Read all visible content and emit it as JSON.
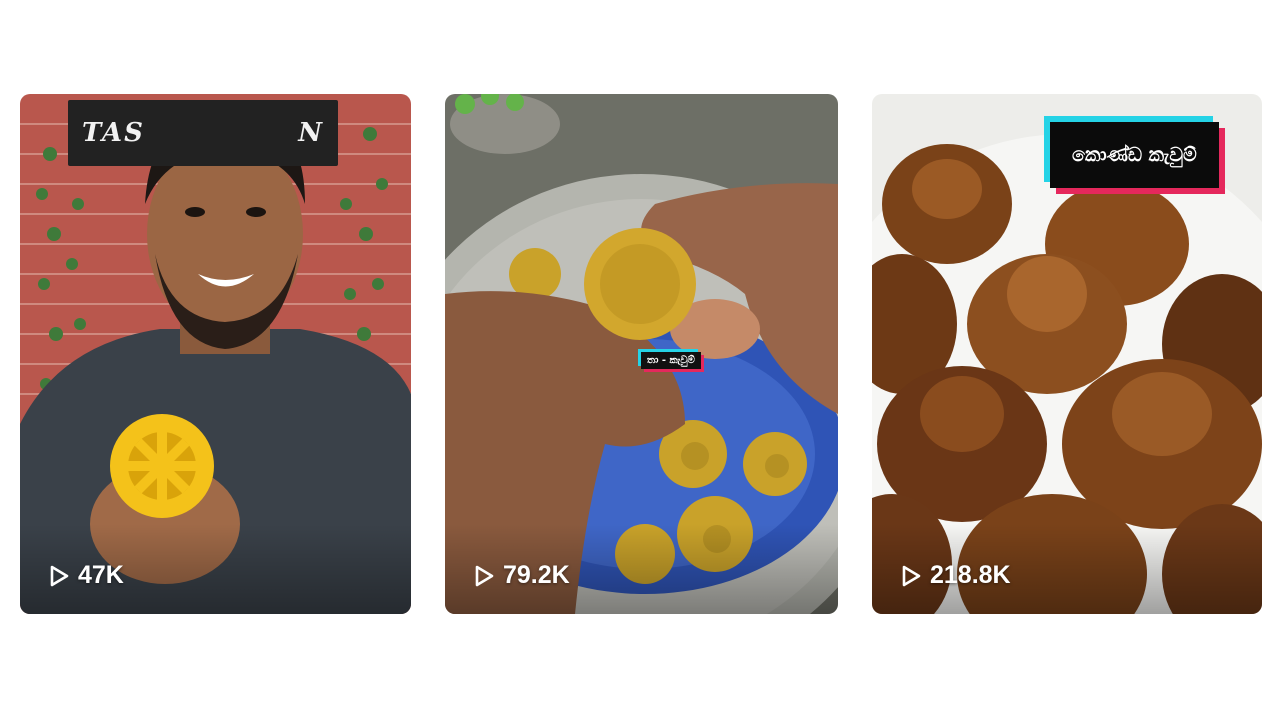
{
  "videos": [
    {
      "views": "47K",
      "thumbnail": "man-holding-yellow-snack",
      "sign_text": "TAS",
      "sign_text_right": "N",
      "caption": ""
    },
    {
      "views": "79.2K",
      "thumbnail": "hand-holding-fried-ball-over-blue-plate",
      "caption": "තා - කැවුම්"
    },
    {
      "views": "218.8K",
      "thumbnail": "konda-kavum-on-white-plate",
      "caption": "කොණ්ඩ කැවුම්"
    }
  ],
  "icons": {
    "views": "play-icon"
  },
  "colors": {
    "caption_cyan": "#25d3e6",
    "caption_red": "#e5285c",
    "view_text": "#ffffff"
  }
}
